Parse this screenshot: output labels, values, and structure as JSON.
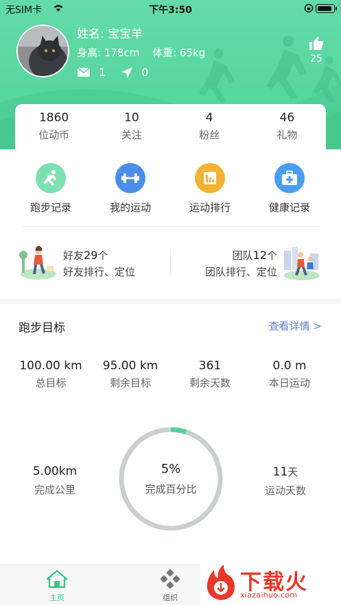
{
  "status_bar": {
    "carrier": "无SIM卡",
    "time": "下午3:50"
  },
  "profile": {
    "name": "姓名: 宝宝羊",
    "height": "身高: 178cm",
    "weight": "体重: 65kg",
    "messages": "1",
    "location": "0",
    "likes": "25"
  },
  "counts": [
    {
      "num": "1860",
      "label": "位动币"
    },
    {
      "num": "10",
      "label": "关注"
    },
    {
      "num": "4",
      "label": "粉丝"
    },
    {
      "num": "46",
      "label": "礼物"
    }
  ],
  "features": [
    {
      "label": "跑步记录",
      "color": "#7ee0b0",
      "icon": "runner-icon"
    },
    {
      "label": "我的运动",
      "color": "#4a8ee8",
      "icon": "dumbbell-icon"
    },
    {
      "label": "运动排行",
      "color": "#f2b233",
      "icon": "bar-chart-icon"
    },
    {
      "label": "健康记录",
      "color": "#4a9ef0",
      "icon": "medical-kit-icon"
    }
  ],
  "friends": {
    "prefix": "好友",
    "count": "29",
    "suffix": "个",
    "sub": "好友排行、定位"
  },
  "team": {
    "prefix": "团队",
    "count": "12",
    "suffix": "个",
    "sub": "团队排行、定位"
  },
  "goal": {
    "title": "跑步目标",
    "link": "查看详情 >",
    "stats": [
      {
        "value": "100.00 km",
        "label": "总目标"
      },
      {
        "value": "95.00 km",
        "label": "剩余目标"
      },
      {
        "value": "361",
        "label": "剩余天数"
      },
      {
        "value": "0.0 m",
        "label": "本日运动"
      }
    ],
    "completed_km": "5.00km",
    "completed_label": "完成公里",
    "percent": "5%",
    "percent_value": 0.05,
    "percent_label": "完成百分比",
    "days": "11",
    "days_unit": "天",
    "days_label": "运动天数"
  },
  "tabbar": {
    "home": "主页",
    "org": "组织"
  },
  "watermark": {
    "brand": "下载火",
    "url": "xiazaihuo.com"
  },
  "colors": {
    "accent": "#52d39a",
    "link": "#5b7ec8",
    "ring_track": "#c9d0cd",
    "ring_fill": "#52d39a"
  }
}
